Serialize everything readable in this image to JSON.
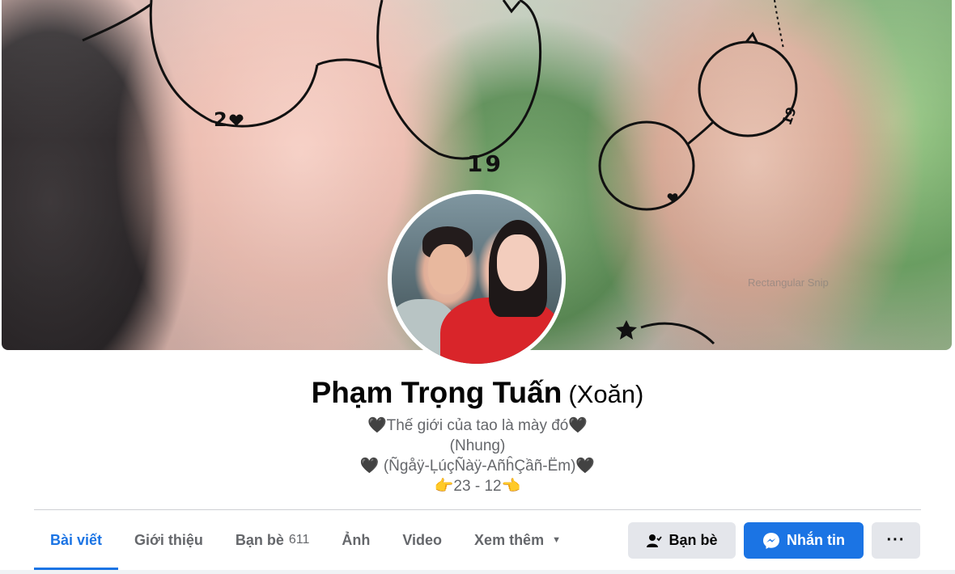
{
  "cover": {
    "doodles": [
      "2",
      "19",
      "19"
    ],
    "watermark": "Rectangular Snip"
  },
  "profile": {
    "name": "Phạm Trọng Tuấn",
    "alt_name": "(Xoăn)",
    "bio": {
      "line1": "Thế giới của tao là mày đó",
      "line2": "(Nhung)",
      "line3": " (Ñgåÿ-ĻúçÑàÿ-AñĥÇầñ-Ëm)",
      "line4": "23 - 12"
    }
  },
  "tabs": [
    {
      "label": "Bài viết",
      "active": true
    },
    {
      "label": "Giới thiệu"
    },
    {
      "label": "Bạn bè",
      "count": "611"
    },
    {
      "label": "Ảnh"
    },
    {
      "label": "Video"
    },
    {
      "label": "Xem thêm"
    }
  ],
  "actions": {
    "friends_label": "Bạn bè",
    "message_label": "Nhắn tin",
    "more_label": "···"
  },
  "colors": {
    "accent": "#1b74e4",
    "secondary_button": "#e4e6eb",
    "muted_text": "#65676b"
  },
  "icons": {
    "friends": "person-check-icon",
    "message": "messenger-icon",
    "more": "ellipsis-icon",
    "dropdown": "caret-down-icon"
  }
}
